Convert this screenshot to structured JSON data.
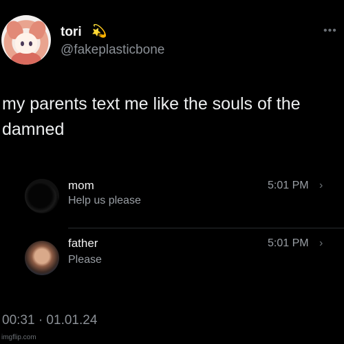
{
  "author": {
    "display_name": "tori",
    "emoji_icon": "dizzy-icon",
    "handle": "@fakeplasticbone",
    "more_icon": "more-icon"
  },
  "tweet": {
    "text": "my parents text me like the souls of the damned",
    "timestamp": "00:31 · 01.01.24"
  },
  "messages": [
    {
      "name": "mom",
      "preview": "Help us please",
      "time": "5:01 PM",
      "chevron_icon": "chevron-right-icon"
    },
    {
      "name": "father",
      "preview": "Please",
      "time": "5:01 PM",
      "chevron_icon": "chevron-right-icon"
    }
  ],
  "watermark": "imgflip.com",
  "colors": {
    "background": "#000000",
    "primary_text": "#e7e9ea",
    "secondary_text": "#8b9096",
    "divider": "#2a2d30"
  }
}
